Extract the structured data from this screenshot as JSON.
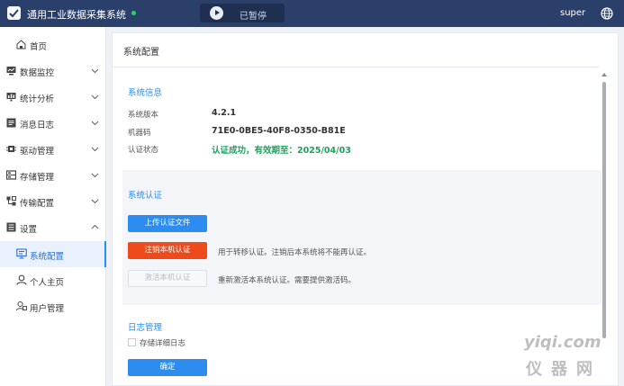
{
  "header": {
    "app_title": "通用工业数据采集系统",
    "run_status": "已暂停",
    "username": "super"
  },
  "colors": {
    "header_bg": "#2b3f6b",
    "accent": "#2d8cf0",
    "success": "#19a55b",
    "danger": "#ee4b1c"
  },
  "sidebar": {
    "items": [
      {
        "label": "首页",
        "icon": "home-icon"
      },
      {
        "label": "数据监控",
        "icon": "monitor-icon"
      },
      {
        "label": "统计分析",
        "icon": "chart-icon"
      },
      {
        "label": "消息日志",
        "icon": "log-icon"
      },
      {
        "label": "驱动管理",
        "icon": "driver-icon"
      },
      {
        "label": "存储管理",
        "icon": "storage-icon"
      },
      {
        "label": "传输配置",
        "icon": "transfer-icon"
      },
      {
        "label": "设置",
        "icon": "settings-icon"
      }
    ],
    "sub_items": [
      {
        "label": "系统配置",
        "icon": "system-config-icon"
      },
      {
        "label": "个人主页",
        "icon": "user-icon"
      },
      {
        "label": "用户管理",
        "icon": "users-icon"
      }
    ]
  },
  "main": {
    "page_title": "系统配置",
    "system_info": {
      "title": "系统信息",
      "rows": [
        {
          "label": "系统版本",
          "value": "4.2.1"
        },
        {
          "label": "机器码",
          "value": "71E0-0BE5-40F8-0350-B81E"
        },
        {
          "label": "认证状态",
          "value": "认证成功，有效期至：2025/04/03"
        }
      ]
    },
    "auth": {
      "title": "系统认证",
      "upload_label": "上传认证文件",
      "revoke_label": "注销本机认证",
      "revoke_note": "用于转移认证。注销后本系统将不能再认证。",
      "activate_label": "激活本机认证",
      "activate_note": "重新激活本系统认证。需要提供激活码。"
    },
    "logs": {
      "title": "日志管理",
      "detail_log_label": "存储详细日志",
      "detail_log_checked": false,
      "confirm_label": "确定"
    }
  },
  "watermark": {
    "top": "yiqi.com",
    "bottom": "仪器网"
  }
}
